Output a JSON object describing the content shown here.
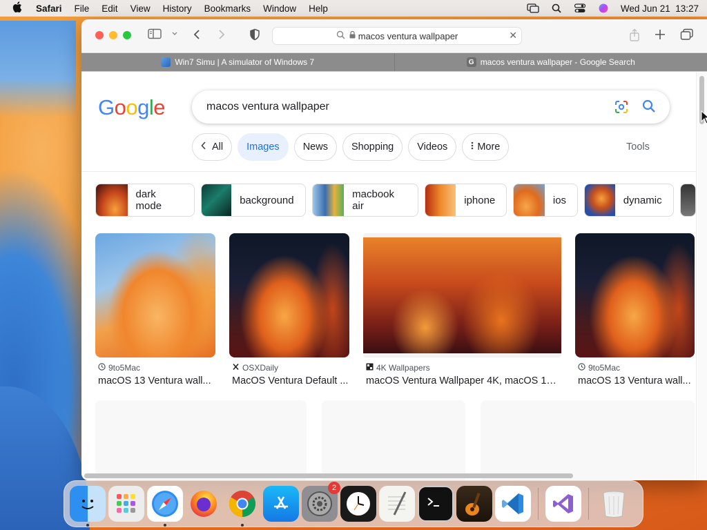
{
  "menubar": {
    "app": "Safari",
    "items": [
      "File",
      "Edit",
      "View",
      "History",
      "Bookmarks",
      "Window",
      "Help"
    ],
    "clock": "Wed Jun 21  13:27"
  },
  "safari": {
    "url": "macos ventura wallpaper",
    "tabs": [
      {
        "label": "Win7 Simu | A simulator of Windows 7",
        "active": false
      },
      {
        "label": "macos ventura wallpaper - Google Search",
        "active": true,
        "favicon": "G"
      }
    ]
  },
  "google": {
    "query": "macos ventura wallpaper",
    "chips": [
      {
        "label": "All",
        "selected": false
      },
      {
        "label": "Images",
        "selected": true
      },
      {
        "label": "News",
        "selected": false
      },
      {
        "label": "Shopping",
        "selected": false
      },
      {
        "label": "Videos",
        "selected": false
      },
      {
        "label": "More",
        "selected": false
      }
    ],
    "tools": "Tools",
    "related": [
      "dark mode",
      "background",
      "macbook air",
      "iphone",
      "ios",
      "dynamic"
    ],
    "results": [
      {
        "source": "9to5Mac",
        "title": "macOS 13 Ventura wall..."
      },
      {
        "source": "OSXDaily",
        "title": "MacOS Ventura Default ..."
      },
      {
        "source": "4K Wallpapers",
        "title": "macOS Ventura Wallpaper 4K, macOS 13 ..."
      },
      {
        "source": "9to5Mac",
        "title": "macOS 13 Ventura wall..."
      }
    ]
  },
  "dock": {
    "apps": [
      "finder-icon",
      "launchpad-icon",
      "safari-icon",
      "firefox-icon",
      "chrome-icon",
      "app-store-icon",
      "system-settings-icon",
      "clock-icon",
      "textedit-icon",
      "terminal-icon",
      "garageband-icon",
      "vscode-icon",
      "visual-studio-icon",
      "trash-icon"
    ],
    "settings_badge": "2"
  },
  "colors": {
    "accent": "#1a73e8",
    "selected_chip_bg": "#e8f0fe",
    "traffic_close": "#ff5f57",
    "traffic_min": "#febc2e",
    "traffic_max": "#28c840"
  }
}
